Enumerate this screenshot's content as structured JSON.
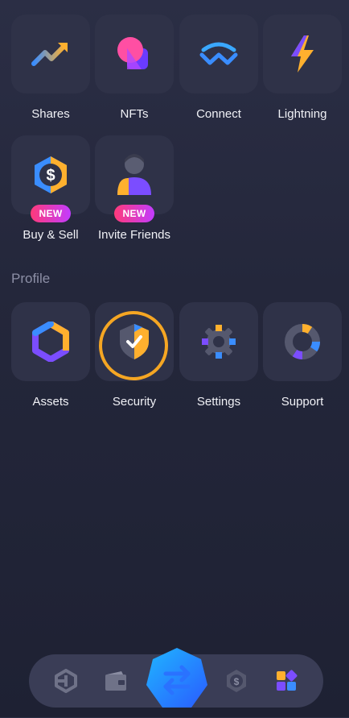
{
  "quick_actions": [
    {
      "label": "Shares",
      "icon": "chart-trend-icon"
    },
    {
      "label": "NFTs",
      "icon": "nft-icon"
    },
    {
      "label": "Connect",
      "icon": "walletconnect-icon"
    },
    {
      "label": "Lightning",
      "icon": "lightning-icon"
    },
    {
      "label": "Buy & Sell",
      "icon": "dollar-coin-icon",
      "badge": "NEW"
    },
    {
      "label": "Invite Friends",
      "icon": "person-icon",
      "badge": "NEW"
    }
  ],
  "profile": {
    "title": "Profile",
    "items": [
      {
        "label": "Assets",
        "icon": "assets-hexagon-icon"
      },
      {
        "label": "Security",
        "icon": "shield-check-icon"
      },
      {
        "label": "Settings",
        "icon": "gear-icon"
      },
      {
        "label": "Support",
        "icon": "lifebuoy-icon"
      }
    ]
  },
  "bottom_nav": [
    {
      "icon": "exodus-logo-icon"
    },
    {
      "icon": "wallet-icon"
    },
    {
      "icon": "swap-arrows-icon"
    },
    {
      "icon": "dollar-hexagon-icon"
    },
    {
      "icon": "apps-grid-icon"
    }
  ],
  "colors": {
    "accent_orange": "#f5a623",
    "badge_gradient_start": "#ff3a7a",
    "badge_gradient_end": "#c23cff",
    "tile_bg": "#2f3248"
  }
}
